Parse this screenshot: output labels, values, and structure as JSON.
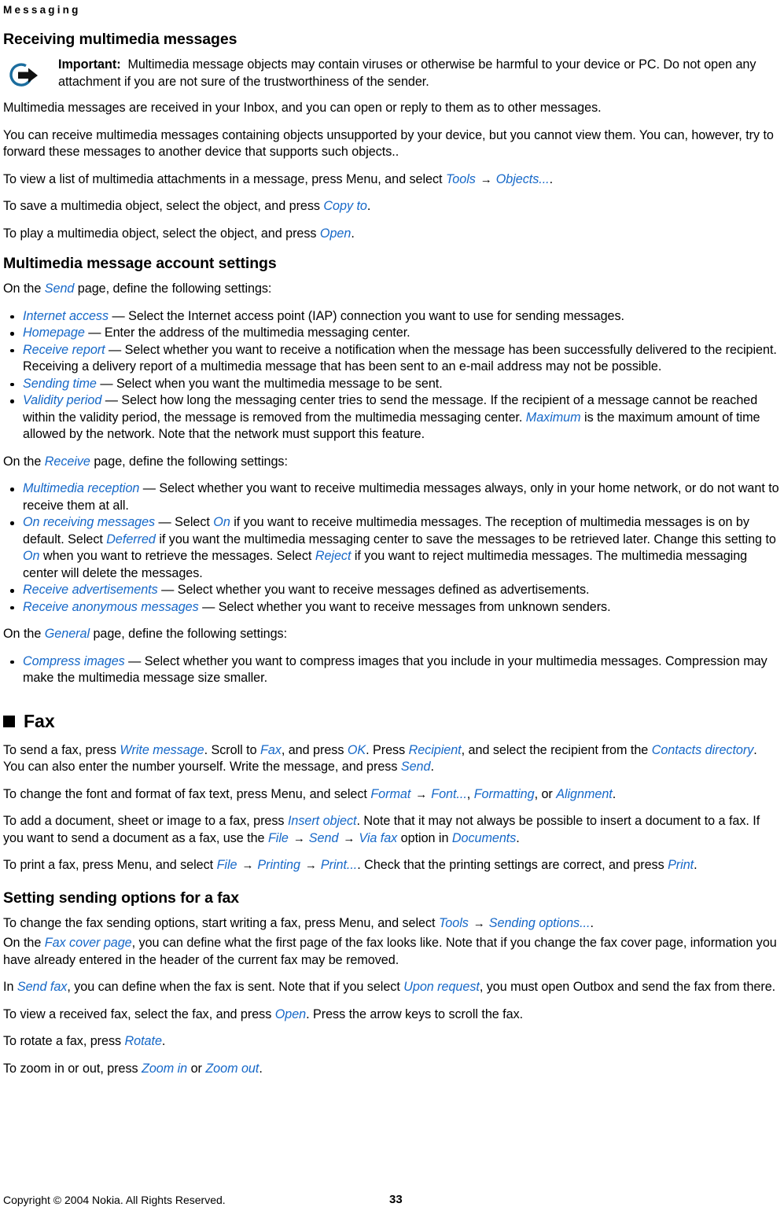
{
  "header": {
    "running_title": "Messaging"
  },
  "sections": {
    "receiving": {
      "heading": "Receiving multimedia messages",
      "note": {
        "icon_name": "important-arrow-icon",
        "lead": "Important:",
        "text": "Multimedia message objects may contain viruses or otherwise be harmful to your device or PC. Do not open any attachment if you are not sure of the trustworthiness of the sender."
      },
      "p1": "Multimedia messages are received in your Inbox, and you can open or reply to them as to other messages.",
      "p2": "You can receive multimedia messages containing objects unsupported by your device, but you cannot view them. You can, however, try to forward these messages to another device that supports such objects..",
      "p3_a": "To view a list of multimedia attachments in a message, press Menu, and select ",
      "p3_ui1": "Tools",
      "p3_arrow": "→",
      "p3_ui2": "Objects...",
      "p3_b": ".",
      "p4_a": "To save a multimedia object, select the object, and press ",
      "p4_ui": "Copy to",
      "p4_b": ".",
      "p5_a": "To play a multimedia object, select the object, and press ",
      "p5_ui": "Open",
      "p5_b": "."
    },
    "account_settings": {
      "heading": "Multimedia message account settings",
      "send_intro_a": "On the ",
      "send_intro_ui": "Send",
      "send_intro_b": " page, define the following settings:",
      "send_bullets": [
        {
          "term": "Internet access",
          "dash": " — ",
          "text": "Select the Internet access point (IAP) connection you want to use for sending messages."
        },
        {
          "term": "Homepage",
          "dash": " — ",
          "text": "Enter the address of the multimedia messaging center."
        },
        {
          "term": "Receive report",
          "dash": " — ",
          "text": "Select whether you want to receive a notification when the message has been successfully delivered to the recipient. Receiving a delivery report of a multimedia message that has been sent to an e-mail address may not be possible."
        },
        {
          "term": "Sending time",
          "dash": " — ",
          "text": "Select when you want the multimedia message to be sent."
        }
      ],
      "validity_bullet": {
        "term": "Validity period",
        "dash": " — ",
        "text_a": "Select how long the messaging center tries to send the message. If the recipient of a message cannot be reached within the validity period, the message is removed from the multimedia messaging center. ",
        "ui1": "Maximum",
        "text_b": " is the maximum amount of time allowed by the network. Note that the network must support this feature."
      },
      "receive_intro_a": "On the ",
      "receive_intro_ui": "Receive",
      "receive_intro_b": " page, define the following settings:",
      "reception_bullet": {
        "term": "Multimedia reception",
        "dash": " — ",
        "text": "Select whether you want to receive multimedia messages always, only in your home network, or do not want to receive them at all."
      },
      "on_receiving_bullet": {
        "term": "On receiving messages",
        "dash": " — ",
        "t1": "Select ",
        "ui1": "On",
        "t2": " if you want to receive multimedia messages. The reception of multimedia messages is on by default. Select ",
        "ui2": "Deferred",
        "t3": " if you want the multimedia messaging center to save the messages to be retrieved later. Change this setting to ",
        "ui3": "On",
        "t4": " when you want to retrieve the messages. Select ",
        "ui4": "Reject",
        "t5": " if you want to reject multimedia messages. The multimedia messaging center will delete the messages."
      },
      "receive_bullets_tail": [
        {
          "term": "Receive advertisements",
          "dash": " — ",
          "text": "Select whether you want to receive messages defined as advertisements."
        },
        {
          "term": "Receive anonymous messages",
          "dash": " — ",
          "text": "Select whether you want to receive messages from unknown senders."
        }
      ],
      "general_intro_a": "On the ",
      "general_intro_ui": "General",
      "general_intro_b": " page, define the following settings:",
      "general_bullet": {
        "term": "Compress images",
        "dash": " — ",
        "text": "Select whether you want to compress images that you include in your multimedia messages. Compression may make the multimedia message size smaller."
      }
    },
    "fax": {
      "heading": "Fax",
      "p1_a": "To send a fax, press ",
      "p1_ui1": "Write message",
      "p1_b": ". Scroll to ",
      "p1_ui2": "Fax",
      "p1_c": ", and press ",
      "p1_ui3": "OK",
      "p1_d": ". Press ",
      "p1_ui4": "Recipient",
      "p1_e": ", and select the recipient from the ",
      "p1_ui5": "Contacts directory",
      "p1_f": ". You can also enter the number yourself. Write the message, and press ",
      "p1_ui6": "Send",
      "p1_g": ".",
      "p2_a": "To change the font and format of fax text, press Menu, and select ",
      "p2_ui1": "Format",
      "p2_arrow": "→",
      "p2_ui2": "Font...",
      "p2_b": ", ",
      "p2_ui3": "Formatting",
      "p2_c": ", or ",
      "p2_ui4": "Alignment",
      "p2_d": ".",
      "p3_a": "To add a document, sheet or image to a fax, press ",
      "p3_ui1": "Insert object",
      "p3_b": ". Note that it may not always be possible to insert a document to a fax. If you want to send a document as a fax, use the ",
      "p3_ui2": "File",
      "p3_arrow1": "→",
      "p3_ui3": "Send",
      "p3_arrow2": "→",
      "p3_ui4": "Via fax",
      "p3_c": " option in ",
      "p3_ui5": "Documents",
      "p3_d": ".",
      "p4_a": "To print a fax, press Menu, and select ",
      "p4_ui1": "File",
      "p4_arrow1": "→",
      "p4_ui2": "Printing",
      "p4_arrow2": "→",
      "p4_ui3": "Print...",
      "p4_b": ". Check that the printing settings are correct, and press ",
      "p4_ui4": "Print",
      "p4_c": "."
    },
    "sending_options": {
      "heading": "Setting sending options for a fax",
      "p1_a": "To change the fax sending options, start writing a fax, press Menu, and select ",
      "p1_ui1": "Tools",
      "p1_arrow": "→",
      "p1_ui2": "Sending options...",
      "p1_b": ".",
      "p2_a": "On the ",
      "p2_ui1": "Fax cover page",
      "p2_b": ", you can define what the first page of the fax looks like. Note that if you change the fax cover page, information you have already entered in the header of the current fax may be removed.",
      "p3_a": "In ",
      "p3_ui1": "Send fax",
      "p3_b": ", you can define when the fax is sent. Note that if you select ",
      "p3_ui2": "Upon request",
      "p3_c": ", you must open Outbox and send the fax from there.",
      "p4_a": "To view a received fax, select the fax, and press ",
      "p4_ui1": "Open",
      "p4_b": ". Press the arrow keys to scroll the fax.",
      "p5_a": "To rotate a fax, press ",
      "p5_ui1": "Rotate",
      "p5_b": ".",
      "p6_a": "To zoom in or out, press ",
      "p6_ui1": "Zoom in",
      "p6_b": " or ",
      "p6_ui2": "Zoom out",
      "p6_c": "."
    }
  },
  "footer": {
    "copyright": "Copyright © 2004 Nokia. All Rights Reserved.",
    "page_number": "33"
  },
  "colors": {
    "link_blue": "#1668c8",
    "icon_blue": "#1b6d9e",
    "text_black": "#000000"
  }
}
